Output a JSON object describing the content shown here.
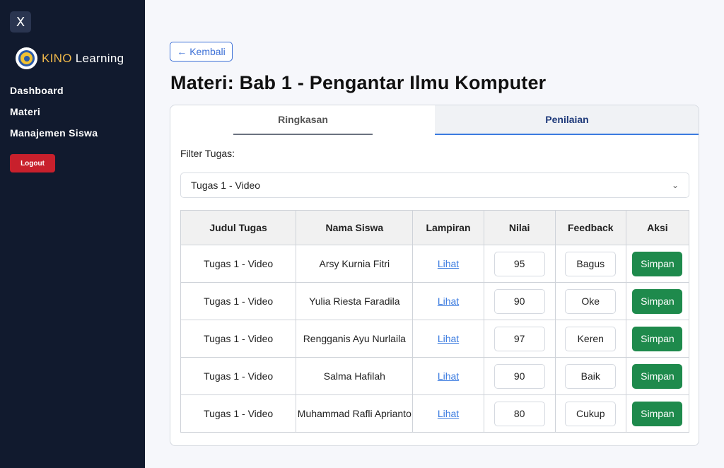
{
  "sidebar": {
    "close_label": "X",
    "brand": {
      "kino": "KINO",
      "learning": "Learning"
    },
    "nav": [
      {
        "label": "Dashboard"
      },
      {
        "label": "Materi"
      },
      {
        "label": "Manajemen Siswa"
      }
    ],
    "logout_label": "Logout"
  },
  "header": {
    "back_label": "Kembali",
    "title": "Materi: Bab 1 - Pengantar Ilmu Komputer"
  },
  "tabs": [
    {
      "label": "Ringkasan",
      "active": false
    },
    {
      "label": "Penilaian",
      "active": true
    }
  ],
  "filter": {
    "label": "Filter Tugas:",
    "selected": "Tugas 1 - Video"
  },
  "table": {
    "headers": [
      "Judul Tugas",
      "Nama Siswa",
      "Lampiran",
      "Nilai",
      "Feedback",
      "Aksi"
    ],
    "rows": [
      {
        "judul": "Tugas 1 - Video",
        "nama": "Arsy Kurnia Fitri",
        "lampiran": "Lihat",
        "nilai": "95",
        "feedback": "Bagus",
        "aksi": "Simpan"
      },
      {
        "judul": "Tugas 1 - Video",
        "nama": "Yulia Riesta Faradila",
        "lampiran": "Lihat",
        "nilai": "90",
        "feedback": "Oke",
        "aksi": "Simpan"
      },
      {
        "judul": "Tugas 1 - Video",
        "nama": "Rengganis Ayu Nurlaila",
        "lampiran": "Lihat",
        "nilai": "97",
        "feedback": "Keren",
        "aksi": "Simpan"
      },
      {
        "judul": "Tugas 1 - Video",
        "nama": "Salma Hafilah",
        "lampiran": "Lihat",
        "nilai": "90",
        "feedback": "Baik",
        "aksi": "Simpan"
      },
      {
        "judul": "Tugas 1 - Video",
        "nama": "Muhammad Rafli Aprianto",
        "lampiran": "Lihat",
        "nilai": "80",
        "feedback": "Cukup",
        "aksi": "Simpan"
      }
    ]
  },
  "colors": {
    "sidebar_bg": "#111a2e",
    "accent": "#3b7be0",
    "save_green": "#1e8a4c",
    "logout_red": "#c8202c"
  }
}
